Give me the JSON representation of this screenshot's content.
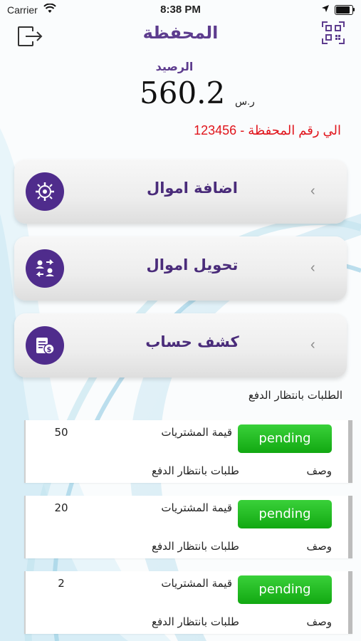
{
  "status_bar": {
    "carrier": "Carrier",
    "time": "8:38 PM"
  },
  "header": {
    "title": "المحفظة",
    "logout_icon": "logout-icon",
    "qr_icon": "qr-scan-icon"
  },
  "balance": {
    "label": "الرصيد",
    "amount": "560.2",
    "currency": "ر.س"
  },
  "wallet_number_text": "الي رقم المحفظة - 123456",
  "actions": [
    {
      "label": "اضافة اموال",
      "icon": "add-money-icon"
    },
    {
      "label": "تحويل اموال",
      "icon": "transfer-money-icon"
    },
    {
      "label": "كشف حساب",
      "icon": "account-statement-icon"
    }
  ],
  "pending_section_title": "الطلبات بانتظار الدفع",
  "orders": [
    {
      "status": "pending",
      "price_label": "قيمة المشتريات",
      "qty": "50",
      "desc_label": "وصف",
      "desc": "طلبات بانتظار الدفع"
    },
    {
      "status": "pending",
      "price_label": "قيمة المشتريات",
      "qty": "20",
      "desc_label": "وصف",
      "desc": "طلبات بانتظار الدفع"
    },
    {
      "status": "pending",
      "price_label": "قيمة المشتريات",
      "qty": "2",
      "desc_label": "وصف",
      "desc": "طلبات بانتظار الدفع"
    }
  ],
  "colors": {
    "primary": "#4f2c8c",
    "title": "#5d3c8e",
    "alert": "#e0141b",
    "badge_green": "#1cb81c"
  }
}
